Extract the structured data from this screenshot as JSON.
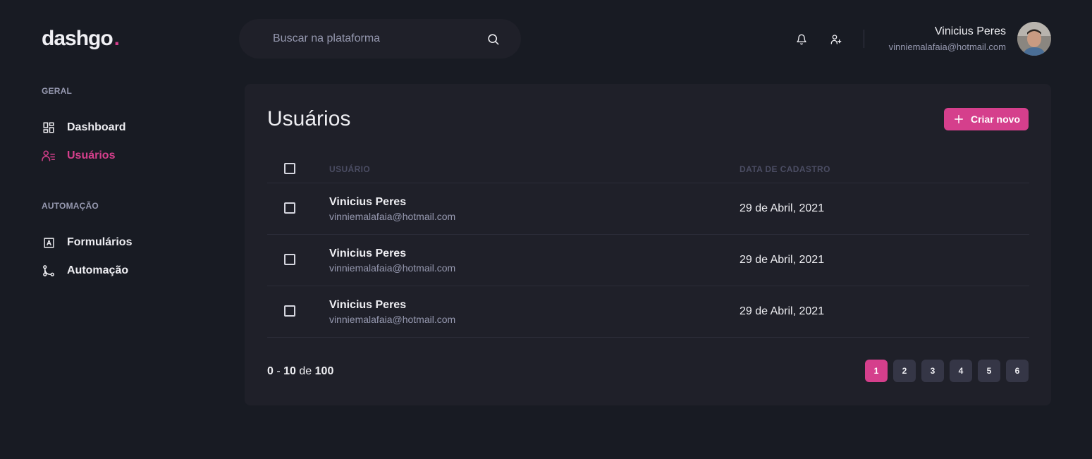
{
  "brand": {
    "name": "dashgo",
    "dot": ".",
    "accent": "#d53f8c"
  },
  "search": {
    "placeholder": "Buscar na plataforma",
    "value": ""
  },
  "header": {
    "icons": [
      "bell-icon",
      "user-plus-icon"
    ],
    "user": {
      "name": "Vinicius Peres",
      "email": "vinniemalafaia@hotmail.com"
    }
  },
  "sidebar": {
    "sections": [
      {
        "title": "GERAL",
        "items": [
          {
            "label": "Dashboard",
            "icon": "dashboard-icon",
            "active": false
          },
          {
            "label": "Usuários",
            "icon": "users-icon",
            "active": true
          }
        ]
      },
      {
        "title": "AUTOMAÇÃO",
        "items": [
          {
            "label": "Formulários",
            "icon": "form-icon",
            "active": false
          },
          {
            "label": "Automação",
            "icon": "git-merge-icon",
            "active": false
          }
        ]
      }
    ]
  },
  "main": {
    "title": "Usuários",
    "create_label": "Criar novo",
    "columns": {
      "user": "USUÁRIO",
      "date": "DATA DE CADASTRO"
    },
    "rows": [
      {
        "name": "Vinicius Peres",
        "email": "vinniemalafaia@hotmail.com",
        "date": "29 de Abril, 2021"
      },
      {
        "name": "Vinicius Peres",
        "email": "vinniemalafaia@hotmail.com",
        "date": "29 de Abril, 2021"
      },
      {
        "name": "Vinicius Peres",
        "email": "vinniemalafaia@hotmail.com",
        "date": "29 de Abril, 2021"
      }
    ],
    "pagination": {
      "start": "0",
      "sep": "-",
      "end": "10",
      "of": "de",
      "total": "100",
      "pages": [
        "1",
        "2",
        "3",
        "4",
        "5",
        "6"
      ],
      "current": "1"
    }
  }
}
